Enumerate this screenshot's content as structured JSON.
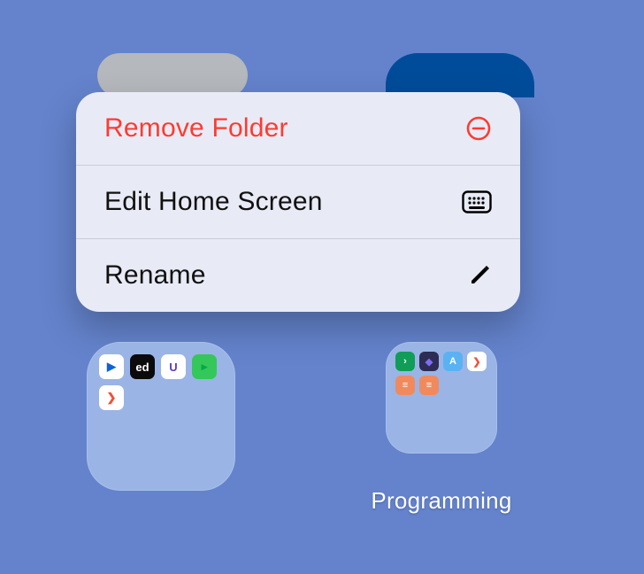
{
  "menu": {
    "remove_label": "Remove Folder",
    "edit_label": "Edit Home Screen",
    "rename_label": "Rename"
  },
  "folders": {
    "right_label": "Programming",
    "left_apps": [
      {
        "bg": "#ffffff",
        "fg": "#0B63D6",
        "sym": "▶"
      },
      {
        "bg": "#0B0B0B",
        "fg": "#ffffff",
        "sym": "ed"
      },
      {
        "bg": "#ffffff",
        "fg": "#5B3CC4",
        "sym": "U"
      },
      {
        "bg": "#34C759",
        "fg": "#0a4",
        "sym": "▸"
      },
      {
        "bg": "#ffffff",
        "fg": "#F05138",
        "sym": "❯"
      }
    ],
    "right_apps": [
      {
        "bg": "#0F9D58",
        "fg": "#ffffff",
        "sym": "›"
      },
      {
        "bg": "#2C2C54",
        "fg": "#7E6CF0",
        "sym": "◆"
      },
      {
        "bg": "#5AB2F2",
        "fg": "#ffffff",
        "sym": "A"
      },
      {
        "bg": "#ffffff",
        "fg": "#F05138",
        "sym": "❯"
      },
      {
        "bg": "#F08A5D",
        "fg": "#ffffff",
        "sym": "≡"
      },
      {
        "bg": "#F08A5D",
        "fg": "#ffffff",
        "sym": "≡"
      }
    ]
  },
  "colors": {
    "destructive": "#FF3B30"
  }
}
